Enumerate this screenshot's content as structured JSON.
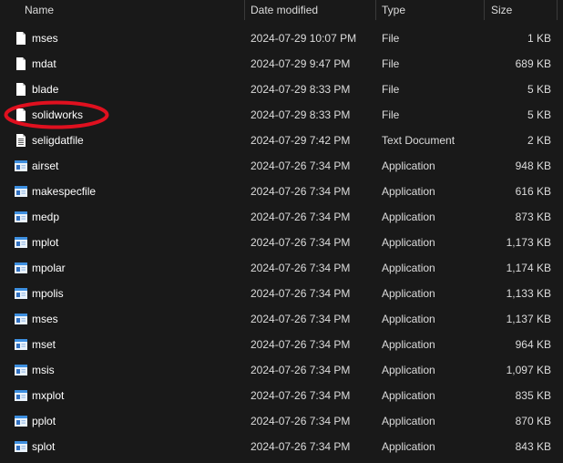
{
  "columns": {
    "name": "Name",
    "date": "Date modified",
    "type": "Type",
    "size": "Size"
  },
  "files": [
    {
      "name": "mses",
      "date": "2024-07-29 10:07 PM",
      "type": "File",
      "size": "1 KB",
      "icon": "file-icon"
    },
    {
      "name": "mdat",
      "date": "2024-07-29 9:47 PM",
      "type": "File",
      "size": "689 KB",
      "icon": "file-icon"
    },
    {
      "name": "blade",
      "date": "2024-07-29 8:33 PM",
      "type": "File",
      "size": "5 KB",
      "icon": "file-icon"
    },
    {
      "name": "solidworks",
      "date": "2024-07-29 8:33 PM",
      "type": "File",
      "size": "5 KB",
      "icon": "file-icon"
    },
    {
      "name": "seligdatfile",
      "date": "2024-07-29 7:42 PM",
      "type": "Text Document",
      "size": "2 KB",
      "icon": "text-document-icon"
    },
    {
      "name": "airset",
      "date": "2024-07-26 7:34 PM",
      "type": "Application",
      "size": "948 KB",
      "icon": "application-icon"
    },
    {
      "name": "makespecfile",
      "date": "2024-07-26 7:34 PM",
      "type": "Application",
      "size": "616 KB",
      "icon": "application-icon"
    },
    {
      "name": "medp",
      "date": "2024-07-26 7:34 PM",
      "type": "Application",
      "size": "873 KB",
      "icon": "application-icon"
    },
    {
      "name": "mplot",
      "date": "2024-07-26 7:34 PM",
      "type": "Application",
      "size": "1,173 KB",
      "icon": "application-icon"
    },
    {
      "name": "mpolar",
      "date": "2024-07-26 7:34 PM",
      "type": "Application",
      "size": "1,174 KB",
      "icon": "application-icon"
    },
    {
      "name": "mpolis",
      "date": "2024-07-26 7:34 PM",
      "type": "Application",
      "size": "1,133 KB",
      "icon": "application-icon"
    },
    {
      "name": "mses",
      "date": "2024-07-26 7:34 PM",
      "type": "Application",
      "size": "1,137 KB",
      "icon": "application-icon"
    },
    {
      "name": "mset",
      "date": "2024-07-26 7:34 PM",
      "type": "Application",
      "size": "964 KB",
      "icon": "application-icon"
    },
    {
      "name": "msis",
      "date": "2024-07-26 7:34 PM",
      "type": "Application",
      "size": "1,097 KB",
      "icon": "application-icon"
    },
    {
      "name": "mxplot",
      "date": "2024-07-26 7:34 PM",
      "type": "Application",
      "size": "835 KB",
      "icon": "application-icon"
    },
    {
      "name": "pplot",
      "date": "2024-07-26 7:34 PM",
      "type": "Application",
      "size": "870 KB",
      "icon": "application-icon"
    },
    {
      "name": "splot",
      "date": "2024-07-26 7:34 PM",
      "type": "Application",
      "size": "843 KB",
      "icon": "application-icon"
    }
  ],
  "colors": {
    "background": "#191919",
    "text": "#ffffff",
    "secondary_text": "#dcdcdc",
    "annotation": "#e0101f",
    "app_icon_blue": "#3d8fe0"
  }
}
